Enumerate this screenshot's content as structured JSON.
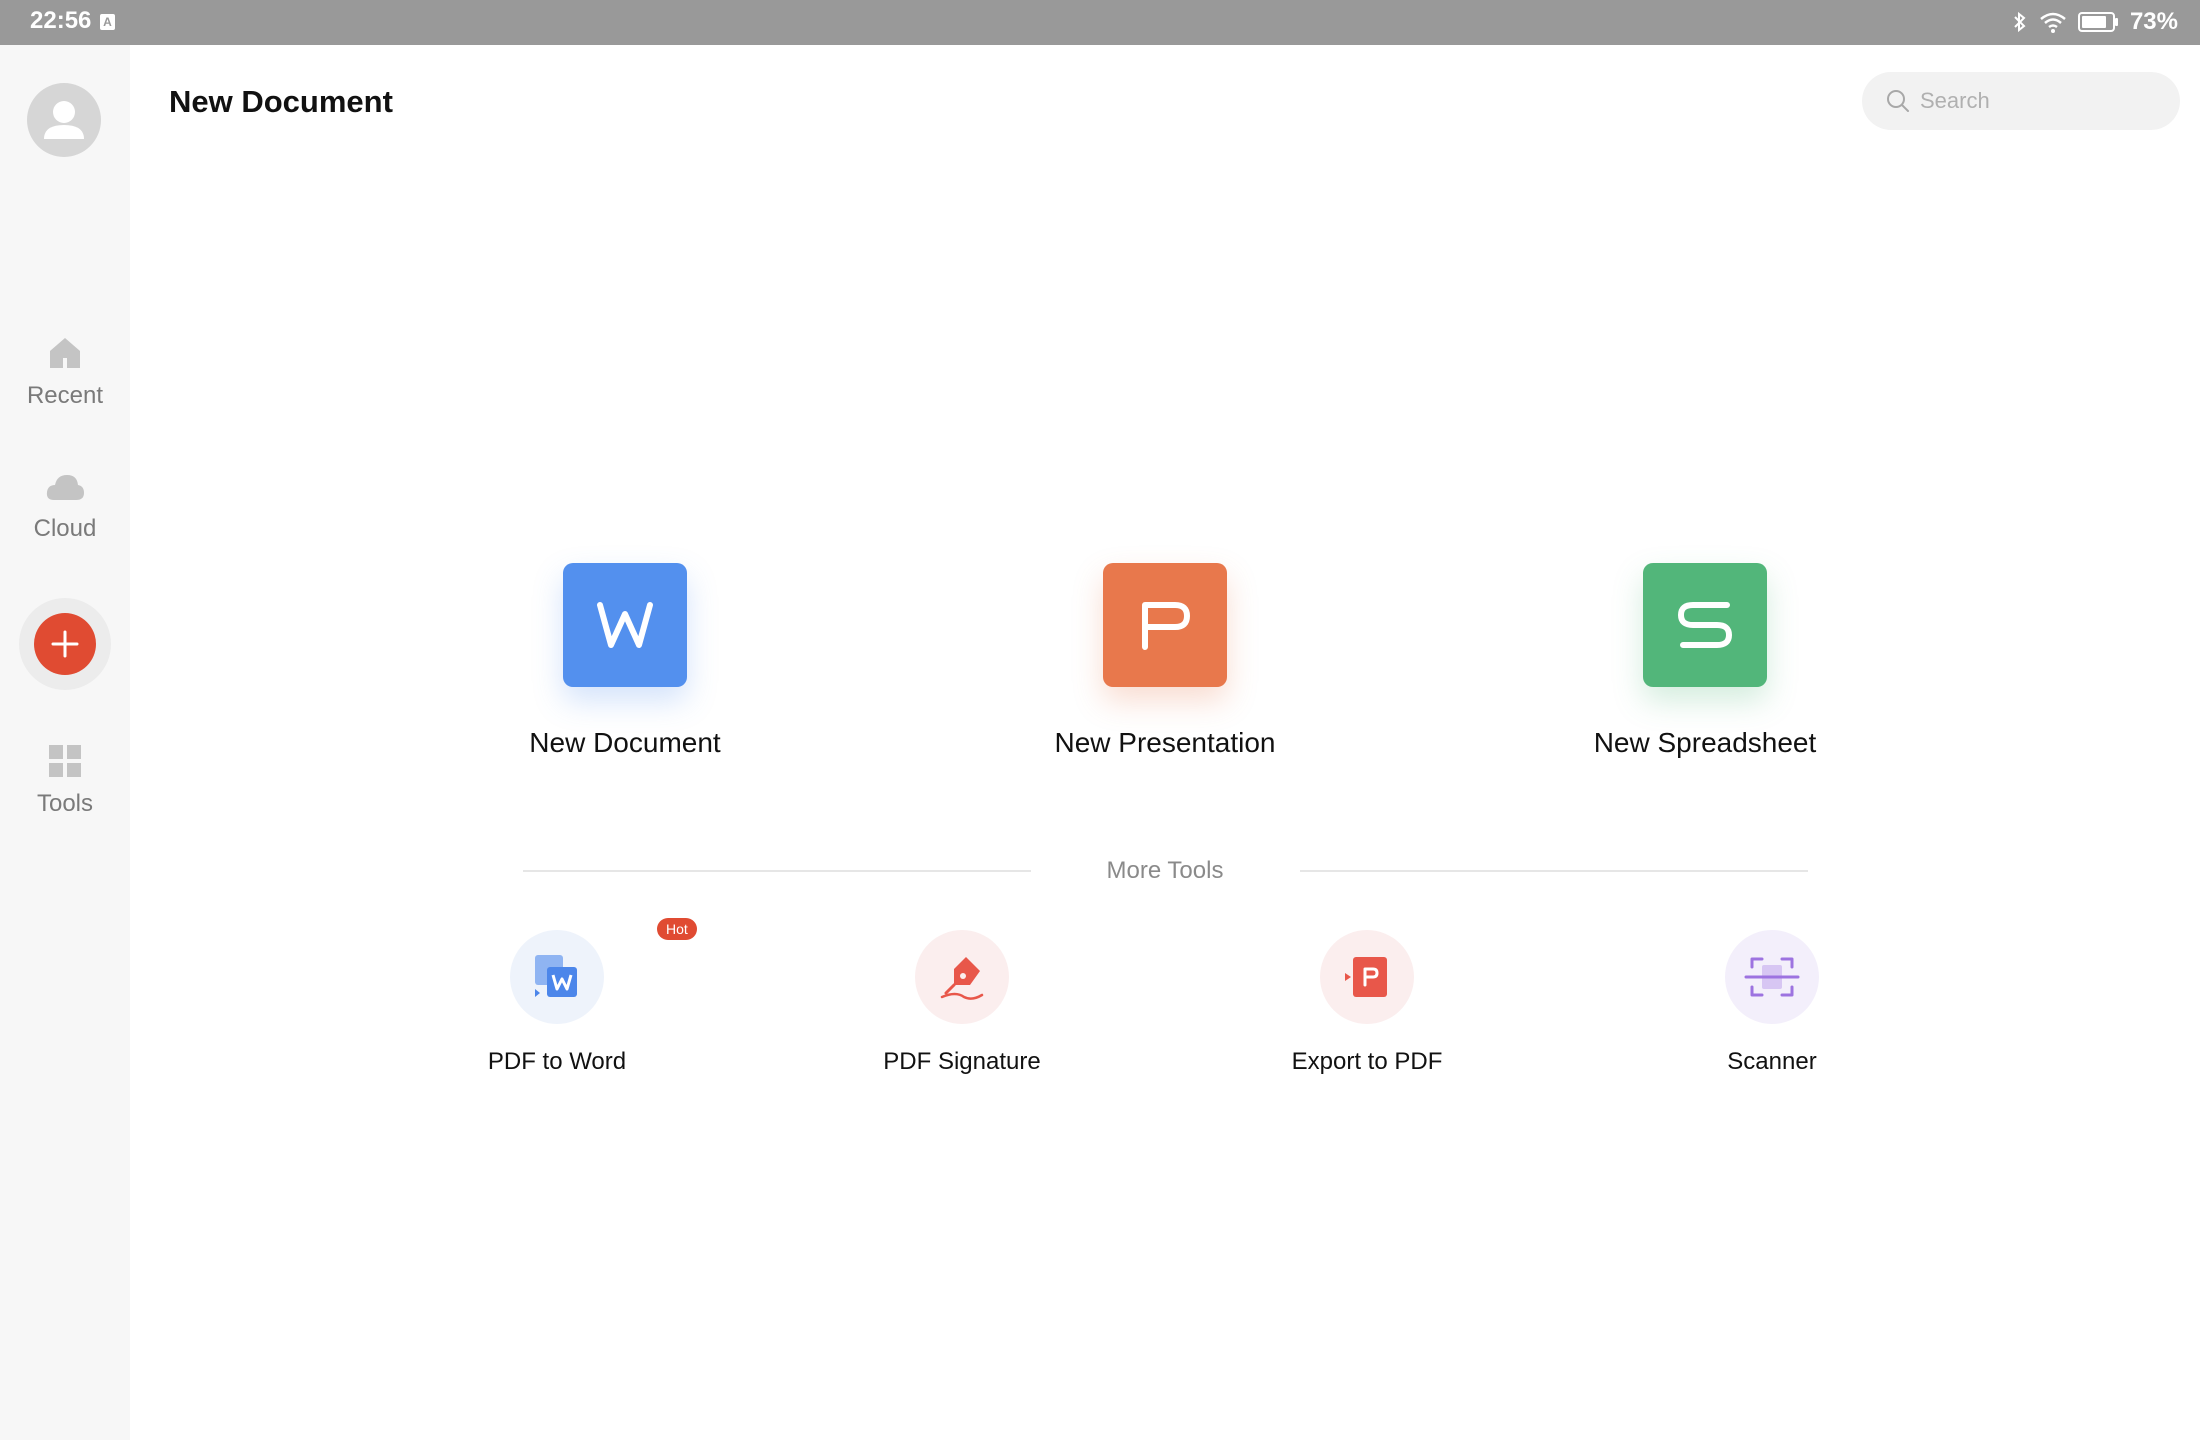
{
  "status_bar": {
    "time": "22:56",
    "battery": "73%"
  },
  "header": {
    "title": "New Document",
    "search_placeholder": "Search"
  },
  "sidebar": {
    "items": [
      {
        "label": "Recent",
        "icon": "home-icon"
      },
      {
        "label": "Cloud",
        "icon": "cloud-icon"
      },
      {
        "label": "Tools",
        "icon": "grid-icon"
      }
    ]
  },
  "create": {
    "document": {
      "label": "New Document",
      "letter": "W",
      "color": "#5390ee"
    },
    "presentation": {
      "label": "New Presentation",
      "letter": "P",
      "color": "#e8784c"
    },
    "spreadsheet": {
      "label": "New Spreadsheet",
      "letter": "S",
      "color": "#52b67a"
    }
  },
  "more_tools": {
    "title": "More Tools",
    "items": [
      {
        "label": "PDF to Word",
        "badge": "Hot"
      },
      {
        "label": "PDF Signature"
      },
      {
        "label": "Export to PDF"
      },
      {
        "label": "Scanner"
      }
    ]
  }
}
